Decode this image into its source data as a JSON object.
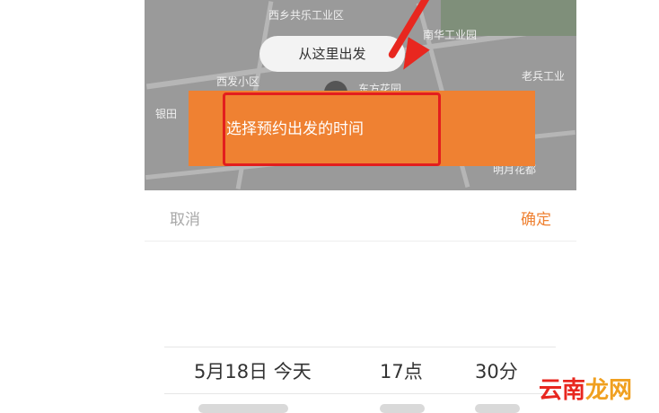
{
  "map": {
    "labels": [
      "西乡共乐工业区",
      "南华工业园",
      "西发小区",
      "老兵工业",
      "银田",
      "东方花园",
      "明月花都"
    ],
    "start_pill": "从这里出发"
  },
  "toast": {
    "text": "选择预约出发的时间"
  },
  "picker": {
    "cancel_label": "取消",
    "confirm_label": "确定",
    "date": "5月18日 今天",
    "hour": "17点",
    "minute": "30分"
  },
  "watermark": {
    "part1": "云南",
    "part2": "龙网"
  },
  "colors": {
    "accent": "#ef8132",
    "annotation_red": "#e31e1e",
    "map_gray": "#9a9a9a"
  }
}
